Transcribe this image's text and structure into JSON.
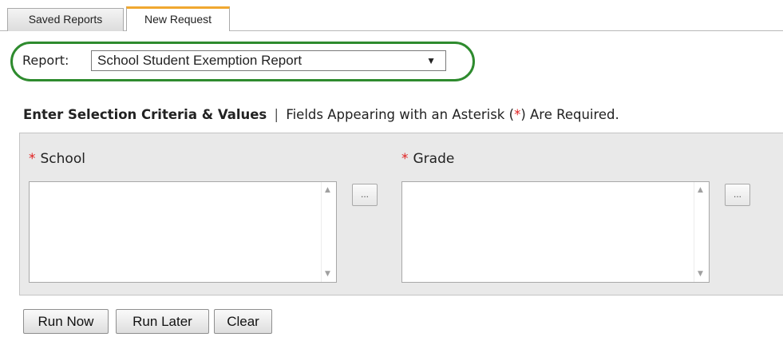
{
  "tabs": [
    {
      "label": "Saved Reports",
      "active": false
    },
    {
      "label": "New Request",
      "active": true
    }
  ],
  "report": {
    "label": "Report:",
    "selected": "School Student Exemption Report"
  },
  "criteria": {
    "heading": "Enter Selection Criteria & Values",
    "separator": "|",
    "note_before": "Fields Appearing with an Asterisk (",
    "note_star": "*",
    "note_after": ") Are Required."
  },
  "fields": [
    {
      "label": "School",
      "required_mark": "*",
      "browse_label": "..."
    },
    {
      "label": "Grade",
      "required_mark": "*",
      "browse_label": "..."
    }
  ],
  "buttons": {
    "run_now": "Run Now",
    "run_later": "Run Later",
    "clear": "Clear"
  },
  "colors": {
    "highlight_oval": "#2e8b2e",
    "active_tab_accent": "#f0a830",
    "required_star": "#e02020"
  }
}
